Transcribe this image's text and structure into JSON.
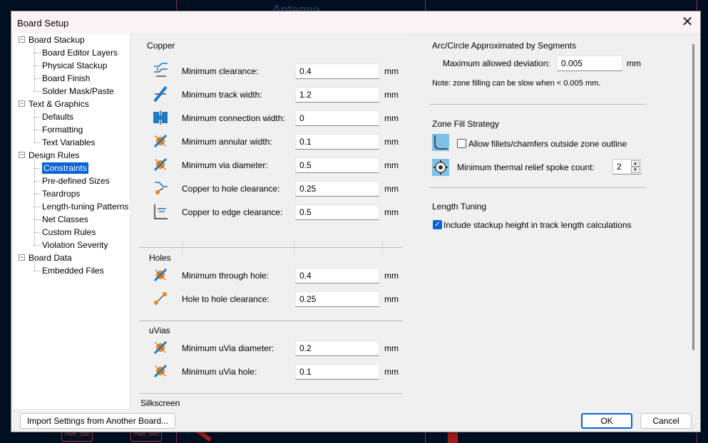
{
  "background": {
    "pcb_text": "Antenna",
    "pads": [
      "PWR_GND",
      "PWR_GND"
    ]
  },
  "dialog": {
    "title": "Board Setup",
    "close_glyph": "✕"
  },
  "tree": {
    "items": [
      {
        "label": "Board Stackup",
        "level": 0
      },
      {
        "label": "Board Editor Layers",
        "level": 1
      },
      {
        "label": "Physical Stackup",
        "level": 1
      },
      {
        "label": "Board Finish",
        "level": 1
      },
      {
        "label": "Solder Mask/Paste",
        "level": 1
      },
      {
        "label": "Text & Graphics",
        "level": 0
      },
      {
        "label": "Defaults",
        "level": 1
      },
      {
        "label": "Formatting",
        "level": 1
      },
      {
        "label": "Text Variables",
        "level": 1
      },
      {
        "label": "Design Rules",
        "level": 0
      },
      {
        "label": "Constraints",
        "level": 1,
        "selected": true
      },
      {
        "label": "Pre-defined Sizes",
        "level": 1
      },
      {
        "label": "Teardrops",
        "level": 1
      },
      {
        "label": "Length-tuning Patterns",
        "level": 1
      },
      {
        "label": "Net Classes",
        "level": 1
      },
      {
        "label": "Custom Rules",
        "level": 1
      },
      {
        "label": "Violation Severity",
        "level": 1
      },
      {
        "label": "Board Data",
        "level": 0
      },
      {
        "label": "Embedded Files",
        "level": 1
      }
    ]
  },
  "copper": {
    "title": "Copper",
    "rows": [
      {
        "label": "Minimum clearance:",
        "value": "0.4",
        "unit": "mm",
        "icon": "clearance-icon"
      },
      {
        "label": "Minimum track width:",
        "value": "1.2",
        "unit": "mm",
        "icon": "track-width-icon"
      },
      {
        "label": "Minimum connection width:",
        "value": "0",
        "unit": "mm",
        "icon": "connection-width-icon"
      },
      {
        "label": "Minimum annular width:",
        "value": "0.1",
        "unit": "mm",
        "icon": "annular-width-icon"
      },
      {
        "label": "Minimum via diameter:",
        "value": "0.5",
        "unit": "mm",
        "icon": "via-diameter-icon"
      },
      {
        "label": "Copper to hole clearance:",
        "value": "0.25",
        "unit": "mm",
        "icon": "hole-clearance-icon"
      },
      {
        "label": "Copper to edge clearance:",
        "value": "0.5",
        "unit": "mm",
        "icon": "edge-clearance-icon"
      }
    ]
  },
  "holes": {
    "title": "Holes",
    "rows": [
      {
        "label": "Minimum through hole:",
        "value": "0.4",
        "unit": "mm",
        "icon": "through-hole-icon"
      },
      {
        "label": "Hole to hole clearance:",
        "value": "0.25",
        "unit": "mm",
        "icon": "hole-to-hole-icon"
      }
    ]
  },
  "uvias": {
    "title": "uVias",
    "rows": [
      {
        "label": "Minimum uVia diameter:",
        "value": "0.2",
        "unit": "mm",
        "icon": "uvia-diameter-icon"
      },
      {
        "label": "Minimum uVia hole:",
        "value": "0.1",
        "unit": "mm",
        "icon": "uvia-hole-icon"
      }
    ]
  },
  "silkscreen": {
    "title": "Silkscreen"
  },
  "arc": {
    "title": "Arc/Circle Approximated by Segments",
    "deviation_label": "Maximum allowed deviation:",
    "deviation_value": "0.005",
    "deviation_unit": "mm",
    "note": "Note: zone filling can be slow when < 0.005 mm."
  },
  "zone_fill": {
    "title": "Zone Fill Strategy",
    "fillets_label": "Allow fillets/chamfers outside zone outline",
    "fillets_checked": false,
    "spoke_label": "Minimum thermal relief spoke count:",
    "spoke_value": "2"
  },
  "length_tuning": {
    "title": "Length Tuning",
    "stackup_label": "Include stackup height in track length calculations",
    "stackup_checked": true
  },
  "buttons": {
    "import_label": "Import Settings from Another Board...",
    "ok_label": "OK",
    "cancel_label": "Cancel"
  },
  "colors": {
    "accent": "#0a64d6",
    "icon_blue": "#1e7ac7",
    "icon_orange": "#e98a16",
    "icon_red": "#c0392b"
  }
}
